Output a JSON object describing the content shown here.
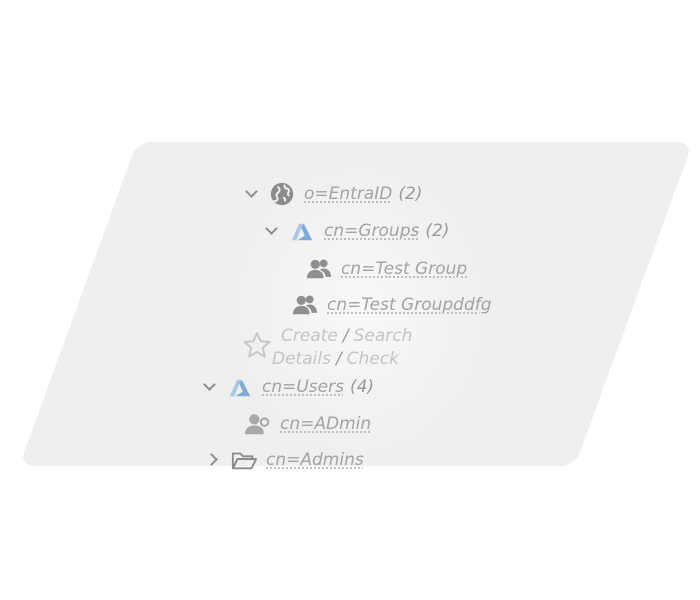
{
  "tree": {
    "root": {
      "label": "o=EntraID",
      "count": "(2)",
      "icon": "globe-icon"
    },
    "groups": {
      "label": "cn=Groups",
      "count": "(2)",
      "icon": "azure-icon"
    },
    "group_items": [
      {
        "label": "cn=Test Group",
        "icon": "users-icon"
      },
      {
        "label": "cn=Test Groupddfg",
        "icon": "users-icon"
      }
    ],
    "actions": {
      "create": "Create",
      "search": "Search",
      "details": "Details",
      "check": "Check",
      "separator": "/",
      "icon": "star-icon"
    },
    "users": {
      "label": "cn=Users",
      "count": "(4)",
      "icon": "azure-icon"
    },
    "user_items": [
      {
        "label": "cn=ADmin",
        "icon": "user-key-icon"
      }
    ],
    "admins": {
      "label": "cn=Admins",
      "icon": "folder-open-icon"
    }
  }
}
